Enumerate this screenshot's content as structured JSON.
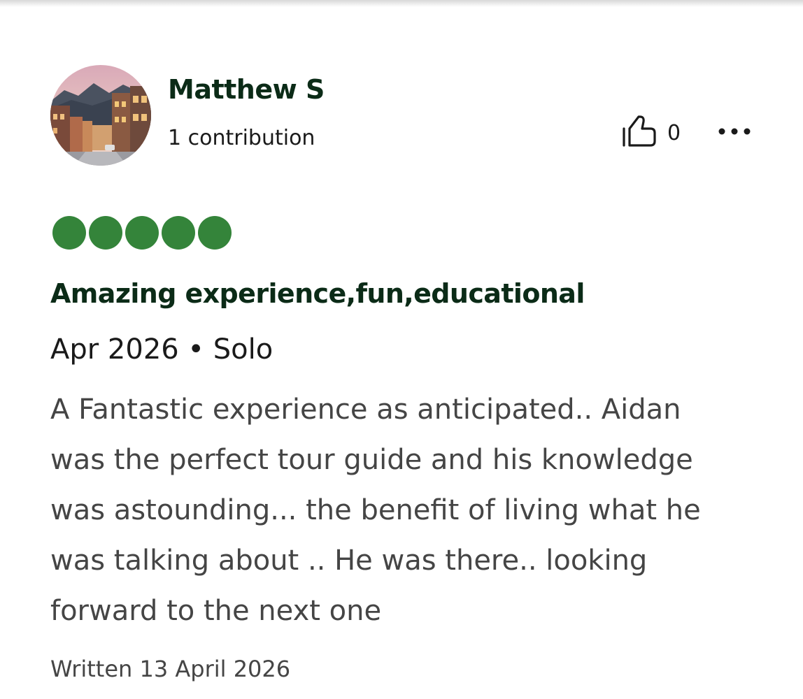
{
  "reviewer": {
    "name": "Matthew S",
    "contributions": "1 contribution",
    "avatar_icon": "street-photo-avatar"
  },
  "actions": {
    "helpful_icon": "thumbs-up-icon",
    "helpful_count": "0",
    "more_icon": "more-options-icon"
  },
  "review": {
    "rating": {
      "value": 5,
      "max": 5,
      "color": "#34843a"
    },
    "title": "Amazing experience,fun,educational",
    "meta": "Apr 2026 • Solo",
    "body_lines": [
      "A Fantastic experience as anticipated.. Aidan",
      "was the perfect tour guide and his knowledge",
      "was astounding... the benefit of living what he",
      "was talking about .. He was there.. looking",
      "forward to the next one"
    ],
    "written": "Written 13 April 2026"
  }
}
